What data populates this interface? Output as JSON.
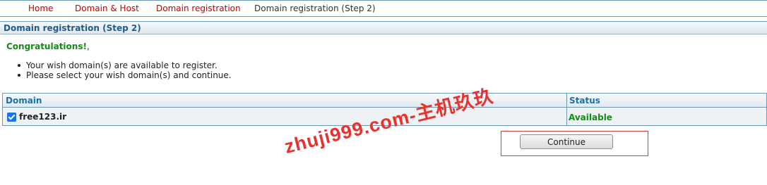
{
  "nav": {
    "home": "Home",
    "domain_host": "Domain & Host",
    "domain_registration": "Domain registration",
    "current": "Domain registration (Step 2)"
  },
  "section": {
    "title": "Domain registration (Step 2)"
  },
  "message": {
    "congrats": "Congratulations!",
    "congrats_tail": ",",
    "bullets": [
      "Your wish domain(s) are available to register.",
      "Please select your wish domain(s) and continue."
    ]
  },
  "table": {
    "headers": {
      "domain": "Domain",
      "status": "Status"
    },
    "rows": [
      {
        "domain": "free123.ir",
        "status": "Available",
        "checked": true
      }
    ]
  },
  "actions": {
    "continue": "Continue"
  },
  "watermark": "zhuji999.com-主机玖玖",
  "colors": {
    "nav_link": "#c00000",
    "header_text": "#1f5b8a",
    "available": "#158a15",
    "watermark": "#e8322e"
  }
}
